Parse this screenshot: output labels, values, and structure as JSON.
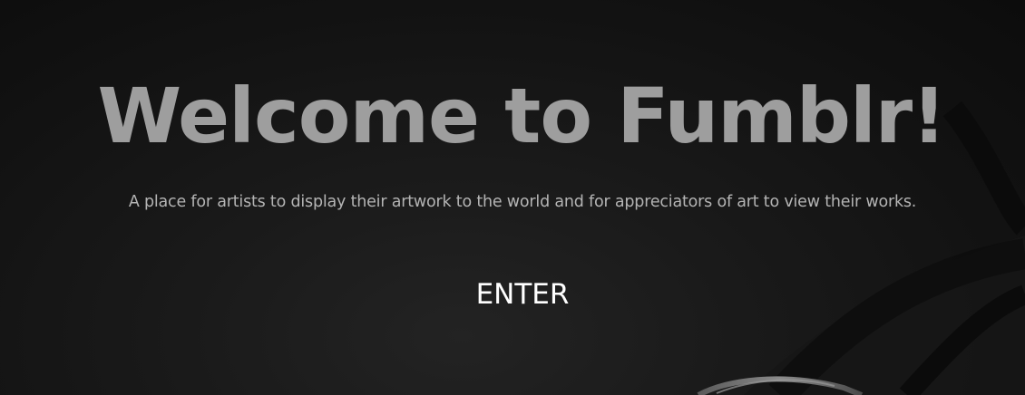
{
  "hero": {
    "title": "Welcome to Fumblr!",
    "tagline": "A place for artists to display their artwork to the world and for appreciators of art to view their works.",
    "enter_label": "ENTER"
  },
  "colors": {
    "background": "#121212",
    "title": "#9e9e9e",
    "tagline": "#b4b4b4",
    "enter": "#ffffff"
  }
}
